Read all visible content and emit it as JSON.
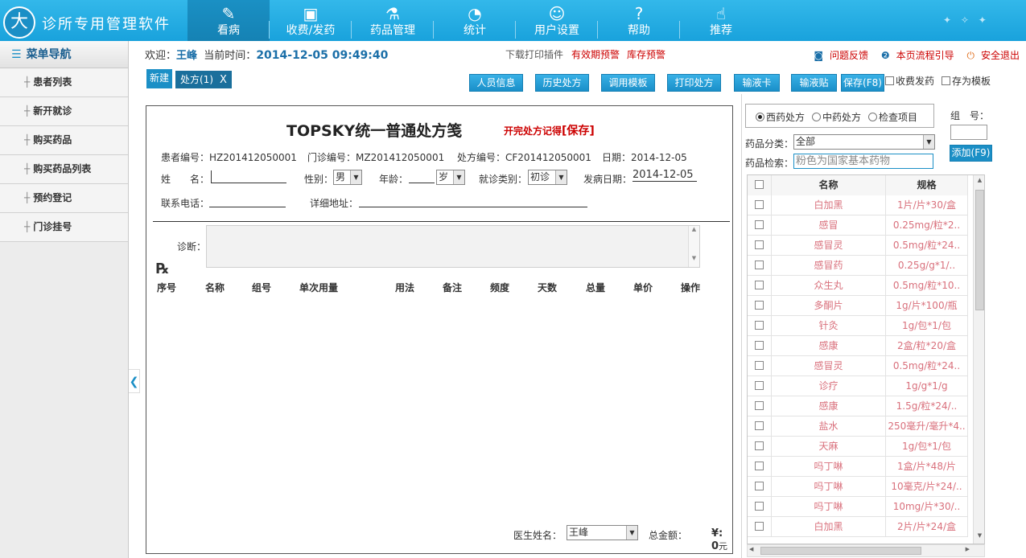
{
  "app": {
    "logo_glyph": "大",
    "title": "诊所专用管理软件",
    "accent": "#1b8fc6"
  },
  "nav": [
    {
      "label": "看病",
      "icon": "feather-icon",
      "glyph": "✎",
      "active": true
    },
    {
      "label": "收费/发药",
      "icon": "cashier-icon",
      "glyph": "▣"
    },
    {
      "label": "药品管理",
      "icon": "flask-icon",
      "glyph": "⚗"
    },
    {
      "label": "统计",
      "icon": "pie-chart-icon",
      "glyph": "◔"
    },
    {
      "label": "用户设置",
      "icon": "users-icon",
      "glyph": "☺"
    },
    {
      "label": "帮助",
      "icon": "help-icon",
      "glyph": "?"
    },
    {
      "label": "推荐",
      "icon": "thumbs-up-icon",
      "glyph": "☝"
    }
  ],
  "sidebar": {
    "title": "菜单导航",
    "items": [
      {
        "label": "患者列表"
      },
      {
        "label": "新开就诊"
      },
      {
        "label": "购买药品"
      },
      {
        "label": "购买药品列表"
      },
      {
        "label": "预约登记"
      },
      {
        "label": "门诊挂号"
      }
    ]
  },
  "header": {
    "welcome_label": "欢迎：",
    "user": "王峰",
    "time_label": "当前时间：",
    "time": "2014-12-05  09:49:40",
    "download": "下载打印插件",
    "expiry_warning": "有效期预警",
    "stock_warning": "库存预警",
    "feedback": "问题反馈",
    "flow_guide": "本页流程引导",
    "logout": "安全退出"
  },
  "toolbar": {
    "new": "新建",
    "tab": "处方(1)",
    "tab_close": "X",
    "buttons": [
      "人员信息",
      "历史处方",
      "调用模板",
      "打印处方",
      "输液卡",
      "输液贴",
      "保存(F8)"
    ],
    "charge_dispense": "收费发药",
    "save_template": "存为模板"
  },
  "form": {
    "title": "TOPSKY统一普通处方笺",
    "note": "开完处方记得",
    "save_link": "[保存]",
    "patient_no_label": "患者编号：",
    "patient_no": "HZ201412050001",
    "clinic_no_label": "门诊编号：",
    "clinic_no": "MZ201412050001",
    "rx_no_label": "处方编号：",
    "rx_no": "CF201412050001",
    "date_label": "日期：",
    "date": "2014-12-05",
    "name_label": "姓　　名：",
    "gender_label": "性别：",
    "gender": "男",
    "age_label": "年龄：",
    "age_unit": "岁",
    "visit_type_label": "就诊类别：",
    "visit_type": "初诊",
    "onset_label": "发病日期：",
    "onset": "2014-12-05",
    "phone_label": "联系电话：",
    "address_label": "详细地址：",
    "diagnosis_label": "诊断：",
    "rx_symbol": "℞",
    "columns": [
      "序号",
      "名称",
      "组号",
      "单次用量",
      "用法",
      "备注",
      "频度",
      "天数",
      "总量",
      "单价",
      "操作"
    ],
    "doctor_label": "医生姓名：",
    "doctor": "王峰",
    "total_label": "总金额：",
    "total": "¥: 0",
    "total_unit": "元"
  },
  "drug_panel": {
    "radios": [
      {
        "label": "西药处方",
        "checked": true
      },
      {
        "label": "中药处方"
      },
      {
        "label": "检查项目"
      }
    ],
    "group_label": "组　号：",
    "add_button": "添加(F9)",
    "category_label": "药品分类：",
    "category": "全部",
    "search_label": "药品检索：",
    "search_placeholder": "粉色为国家基本药物",
    "col_name": "名称",
    "col_spec": "规格",
    "row_color": "#d9707c",
    "rows": [
      {
        "name": "白加黑",
        "spec": "1片/片*30/盒"
      },
      {
        "name": "感冒",
        "spec": "0.25mg/粒*2.."
      },
      {
        "name": "感冒灵",
        "spec": "0.5mg/粒*24.."
      },
      {
        "name": "感冒药",
        "spec": "0.25g/g*1/.."
      },
      {
        "name": "众生丸",
        "spec": "0.5mg/粒*10.."
      },
      {
        "name": "多酮片",
        "spec": "1g/片*100/瓶"
      },
      {
        "name": "针灸",
        "spec": "1g/包*1/包"
      },
      {
        "name": "感康",
        "spec": "2盒/粒*20/盒"
      },
      {
        "name": "感冒灵",
        "spec": "0.5mg/粒*24.."
      },
      {
        "name": "诊疗",
        "spec": "1g/g*1/g"
      },
      {
        "name": "感康",
        "spec": "1.5g/粒*24/.."
      },
      {
        "name": "盐水",
        "spec": "250毫升/毫升*4.."
      },
      {
        "name": "天麻",
        "spec": "1g/包*1/包"
      },
      {
        "name": "吗丁啉",
        "spec": "1盒/片*48/片"
      },
      {
        "name": "吗丁啉",
        "spec": "10毫克/片*24/.."
      },
      {
        "name": "吗丁啉",
        "spec": "10mg/片*30/.."
      },
      {
        "name": "白加黑",
        "spec": "2片/片*24/盒"
      }
    ]
  }
}
